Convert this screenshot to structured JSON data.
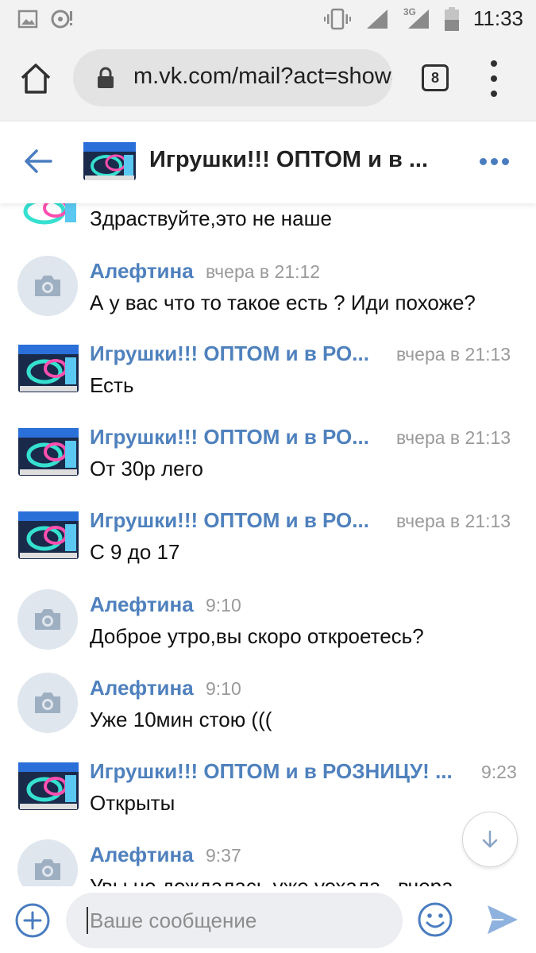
{
  "status_bar": {
    "time": "11:33",
    "network": "3G"
  },
  "browser": {
    "url": "m.vk.com/mail?act=show&chat",
    "tab_count": "8"
  },
  "chat": {
    "title": "Игрушки!!! ОПТОМ и в ..."
  },
  "messages": [
    {
      "author": "",
      "time": "",
      "text": "Здраствуйте,это не наше"
    },
    {
      "author": "Алефтина",
      "time": "вчера в 21:12",
      "text": "А у вас что то такое есть ? Иди похоже?"
    },
    {
      "author": "Игрушки!!! ОПТОМ и в РО...",
      "time": "вчера в 21:13",
      "text": "Есть"
    },
    {
      "author": "Игрушки!!! ОПТОМ и в РО...",
      "time": "вчера в 21:13",
      "text": "От 30р лего"
    },
    {
      "author": "Игрушки!!! ОПТОМ и в РО...",
      "time": "вчера в 21:13",
      "text": "С 9 до 17"
    },
    {
      "author": "Алефтина",
      "time": "9:10",
      "text": "Доброе утро,вы скоро откроетесь?"
    },
    {
      "author": "Алефтина",
      "time": "9:10",
      "text": "Уже 10мин стою ((("
    },
    {
      "author": "Игрушки!!! ОПТОМ и в РОЗНИЦУ! ...",
      "time": "9:23",
      "text": "Открыты"
    },
    {
      "author": "Алефтина",
      "time": "9:37",
      "text": "Увы,не дождалась,уже уехала...вчера"
    }
  ],
  "composer": {
    "placeholder": "Ваше сообщение"
  },
  "colors": {
    "accent": "#4f81bd",
    "author": "#4f81bd",
    "timestamp": "#9a9a9a",
    "send": "#8fb1dd"
  },
  "icons": [
    "image-icon",
    "media-icon",
    "vibrate-icon",
    "signal-icon",
    "battery-icon",
    "home-icon",
    "lock-icon",
    "tabs-icon",
    "menu-icon",
    "back-arrow-icon",
    "more-icon",
    "camera-icon",
    "arrow-down-icon",
    "plus-icon",
    "emoji-icon",
    "send-icon"
  ]
}
